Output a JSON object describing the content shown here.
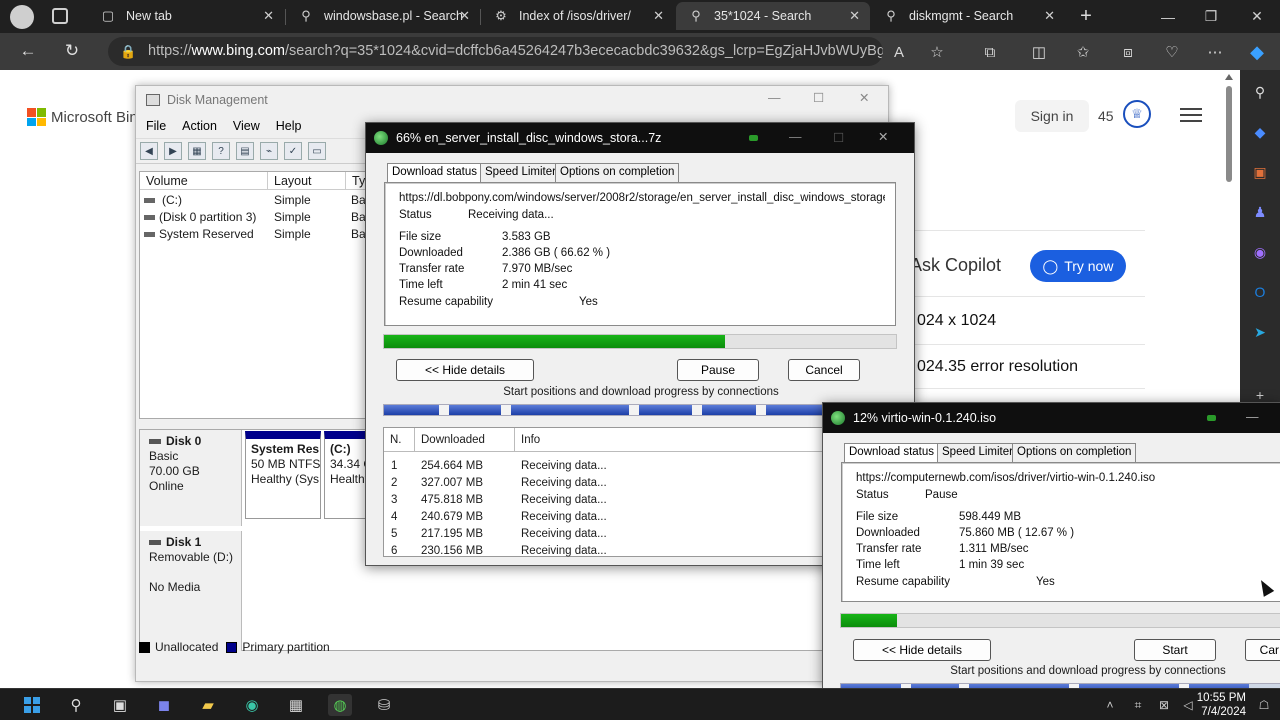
{
  "browser": {
    "tabs": [
      {
        "label": "New tab",
        "icon": "tab-page-icon"
      },
      {
        "label": "windowsbase.pl - Search",
        "icon": "search-icon"
      },
      {
        "label": "Index of /isos/driver/",
        "icon": "web-icon"
      },
      {
        "label": "35*1024 - Search",
        "icon": "search-icon"
      },
      {
        "label": "diskmgmt - Search",
        "icon": "search-icon"
      }
    ],
    "url_prefix": "https://",
    "url_domain": "www.bing.com",
    "url_rest": "/search?q=35*1024&cvid=dcffcb6a45264247b3ececacbdc39632&gs_lcrp=EgZjaHJvbWUyBgg..."
  },
  "bing": {
    "logo_text": "Microsoft Bing",
    "signin": "Sign in",
    "rewards": "45",
    "ask_copilot": "Ask Copilot",
    "try_now": "Try now",
    "suggestion_1": "024 x 1024",
    "suggestion_2": "024.35 error resolution"
  },
  "disk_management": {
    "title": "Disk Management",
    "menu": [
      "File",
      "Action",
      "View",
      "Help"
    ],
    "columns": [
      "Volume",
      "Layout",
      "Typ"
    ],
    "volumes": [
      {
        "volume": "(C:)",
        "layout": "Simple",
        "type": "Bas"
      },
      {
        "volume": "(Disk 0 partition 3)",
        "layout": "Simple",
        "type": "Bas"
      },
      {
        "volume": "System Reserved",
        "layout": "Simple",
        "type": "Bas"
      }
    ],
    "disk0": {
      "name": "Disk 0",
      "type": "Basic",
      "size": "70.00 GB",
      "status": "Online"
    },
    "disk0_partitions": [
      {
        "name": "System Res",
        "detail": "50 MB NTFS",
        "health": "Healthy (Sys"
      },
      {
        "name": "(C:)",
        "detail": "34.34 G",
        "health": "Healthy"
      }
    ],
    "disk1": {
      "name": "Disk 1",
      "type": "Removable (D:)",
      "status": "No Media"
    },
    "legend": [
      {
        "label": "Unallocated",
        "color": "#000000"
      },
      {
        "label": "Primary partition",
        "color": "#00008b"
      }
    ]
  },
  "idm_main": {
    "title": "66% en_server_install_disc_windows_stora...7z",
    "tabs": [
      "Download status",
      "Speed Limiter",
      "Options on completion"
    ],
    "url": "https://dl.bobpony.com/windows/server/2008r2/storage/en_server_install_disc_windows_storage_s",
    "status_label": "Status",
    "status_value": "Receiving data...",
    "file_size_label": "File size",
    "file_size": "3.583  GB",
    "downloaded_label": "Downloaded",
    "downloaded": "2.386  GB  ( 66.62 % )",
    "rate_label": "Transfer rate",
    "rate": "7.970  MB/sec",
    "time_left_label": "Time left",
    "time_left": "2 min 41 sec",
    "resume_label": "Resume capability",
    "resume": "Yes",
    "progress_percent": 66.62,
    "hide_details": "<< Hide details",
    "pause": "Pause",
    "cancel": "Cancel",
    "connections_caption": "Start positions and download progress by connections",
    "conn_headers": [
      "N.",
      "Downloaded",
      "Info"
    ],
    "connections": [
      {
        "n": "1",
        "downloaded": "254.664  MB",
        "info": "Receiving data..."
      },
      {
        "n": "2",
        "downloaded": "327.007  MB",
        "info": "Receiving data..."
      },
      {
        "n": "3",
        "downloaded": "475.818  MB",
        "info": "Receiving data..."
      },
      {
        "n": "4",
        "downloaded": "240.679  MB",
        "info": "Receiving data..."
      },
      {
        "n": "5",
        "downloaded": "217.195  MB",
        "info": "Receiving data..."
      },
      {
        "n": "6",
        "downloaded": "230.156  MB",
        "info": "Receiving data..."
      }
    ]
  },
  "idm_second": {
    "title": "12% virtio-win-0.1.240.iso",
    "tabs": [
      "Download status",
      "Speed Limiter",
      "Options on completion"
    ],
    "url": "https://computernewb.com/isos/driver/virtio-win-0.1.240.iso",
    "status_label": "Status",
    "status_value": "Pause",
    "file_size_label": "File size",
    "file_size": "598.449  MB",
    "downloaded_label": "Downloaded",
    "downloaded": "75.860  MB  ( 12.67 % )",
    "rate_label": "Transfer rate",
    "rate": "1.311  MB/sec",
    "time_left_label": "Time left",
    "time_left": "1 min 39 sec",
    "resume_label": "Resume capability",
    "resume": "Yes",
    "progress_percent": 12.67,
    "hide_details": "<< Hide details",
    "start": "Start",
    "cancel": "Car",
    "connections_caption": "Start positions and download progress by connections"
  },
  "taskbar": {
    "time": "10:55 PM",
    "date": "7/4/2024"
  }
}
